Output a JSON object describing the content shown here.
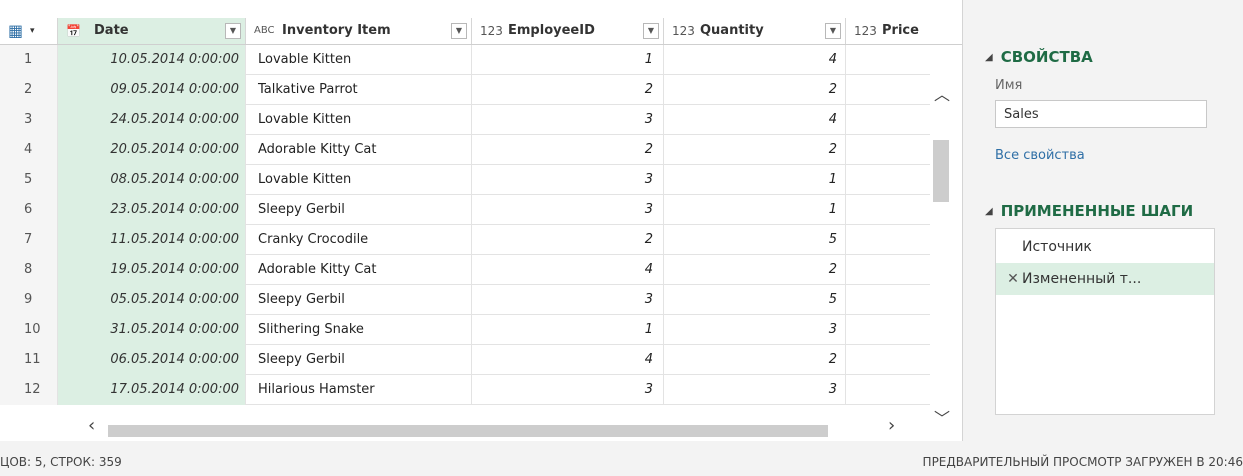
{
  "columns": {
    "table_icon": "▦",
    "date": {
      "type": "📅",
      "label": "Date"
    },
    "item": {
      "type": "ABC",
      "label": "Inventory Item"
    },
    "emp": {
      "type": "123",
      "label": "EmployeeID"
    },
    "qty": {
      "type": "123",
      "label": "Quantity"
    },
    "price": {
      "type": "123",
      "label": "Price"
    }
  },
  "rows": [
    {
      "n": "1",
      "date": "10.05.2014 0:00:00",
      "item": "Lovable Kitten",
      "emp": "1",
      "qty": "4"
    },
    {
      "n": "2",
      "date": "09.05.2014 0:00:00",
      "item": "Talkative Parrot",
      "emp": "2",
      "qty": "2"
    },
    {
      "n": "3",
      "date": "24.05.2014 0:00:00",
      "item": "Lovable Kitten",
      "emp": "3",
      "qty": "4"
    },
    {
      "n": "4",
      "date": "20.05.2014 0:00:00",
      "item": "Adorable Kitty Cat",
      "emp": "2",
      "qty": "2"
    },
    {
      "n": "5",
      "date": "08.05.2014 0:00:00",
      "item": "Lovable Kitten",
      "emp": "3",
      "qty": "1"
    },
    {
      "n": "6",
      "date": "23.05.2014 0:00:00",
      "item": "Sleepy Gerbil",
      "emp": "3",
      "qty": "1"
    },
    {
      "n": "7",
      "date": "11.05.2014 0:00:00",
      "item": "Cranky Crocodile",
      "emp": "2",
      "qty": "5"
    },
    {
      "n": "8",
      "date": "19.05.2014 0:00:00",
      "item": "Adorable Kitty Cat",
      "emp": "4",
      "qty": "2"
    },
    {
      "n": "9",
      "date": "05.05.2014 0:00:00",
      "item": "Sleepy Gerbil",
      "emp": "3",
      "qty": "5"
    },
    {
      "n": "10",
      "date": "31.05.2014 0:00:00",
      "item": "Slithering Snake",
      "emp": "1",
      "qty": "3"
    },
    {
      "n": "11",
      "date": "06.05.2014 0:00:00",
      "item": "Sleepy Gerbil",
      "emp": "4",
      "qty": "2"
    },
    {
      "n": "12",
      "date": "17.05.2014 0:00:00",
      "item": "Hilarious Hamster",
      "emp": "3",
      "qty": "3"
    }
  ],
  "panel": {
    "props_title": "СВОЙСТВА",
    "name_label": "Имя",
    "name_value": "Sales",
    "all_props": "Все свойства",
    "steps_title": "ПРИМЕНЕННЫЕ ШАГИ",
    "steps": [
      {
        "label": "Источник"
      },
      {
        "label": "Измененный т..."
      }
    ]
  },
  "status": {
    "left": "ЦОВ: 5, СТРОК: 359",
    "right": "ПРЕДВАРИТЕЛЬНЫЙ ПРОСМОТР ЗАГРУЖЕН В 20:46"
  }
}
